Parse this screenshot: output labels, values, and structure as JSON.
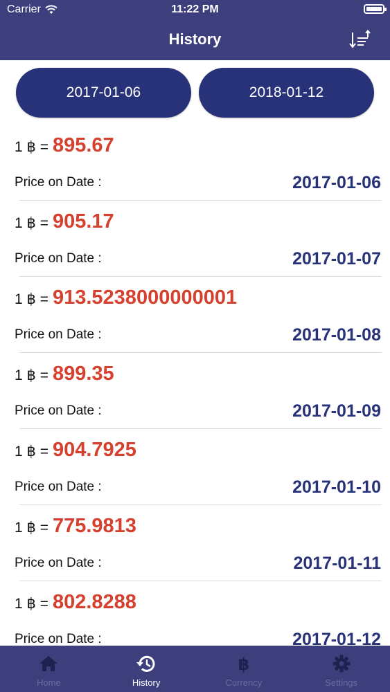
{
  "status_bar": {
    "carrier": "Carrier",
    "time": "11:22 PM"
  },
  "header": {
    "title": "History",
    "sort_icon": "sort-icon"
  },
  "date_range": {
    "start": "2017-01-06",
    "end": "2018-01-12"
  },
  "labels": {
    "rate_prefix": "1 ฿ =",
    "price_on_date": "Price on Date :"
  },
  "history": [
    {
      "value": "895.67",
      "date": "2017-01-06"
    },
    {
      "value": "905.17",
      "date": "2017-01-07"
    },
    {
      "value": "913.5238000000001",
      "date": "2017-01-08"
    },
    {
      "value": "899.35",
      "date": "2017-01-09"
    },
    {
      "value": "904.7925",
      "date": "2017-01-10"
    },
    {
      "value": "775.9813",
      "date": "2017-01-11"
    },
    {
      "value": "802.8288",
      "date": "2017-01-12"
    }
  ],
  "tabs": [
    {
      "label": "Home",
      "icon": "home-icon"
    },
    {
      "label": "History",
      "icon": "history-icon"
    },
    {
      "label": "Currency",
      "icon": "bitcoin-icon"
    },
    {
      "label": "Settings",
      "icon": "gear-icon"
    }
  ],
  "colors": {
    "primary": "#283278",
    "nav_bar": "#3d3f7d",
    "price": "#d5412e",
    "tab_inactive": "#6a6da5"
  }
}
